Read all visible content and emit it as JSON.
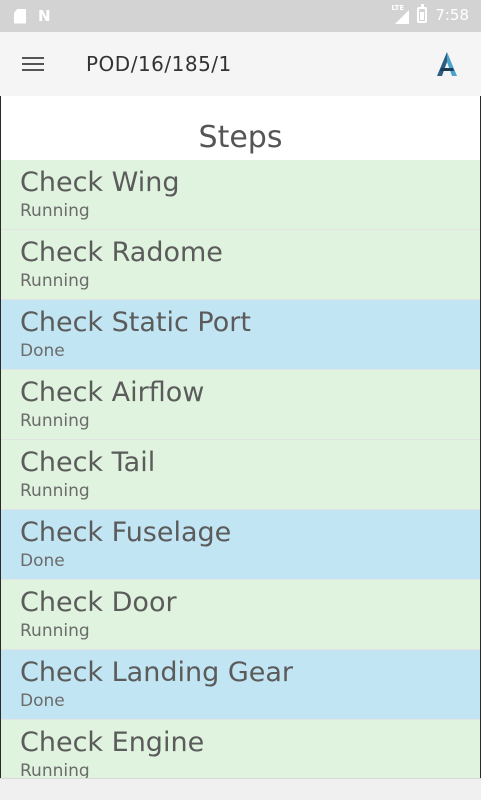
{
  "status_bar": {
    "network_label": "LTE",
    "time": "7:58"
  },
  "app_bar": {
    "title": "POD/16/185/1"
  },
  "page": {
    "heading": "Steps"
  },
  "colors": {
    "running": "#dff3de",
    "done": "#c2e5f3"
  },
  "steps": [
    {
      "name": "Check Wing",
      "status": "Running"
    },
    {
      "name": "Check Radome",
      "status": "Running"
    },
    {
      "name": "Check Static Port",
      "status": "Done"
    },
    {
      "name": "Check Airflow",
      "status": "Running"
    },
    {
      "name": "Check Tail",
      "status": "Running"
    },
    {
      "name": "Check Fuselage",
      "status": "Done"
    },
    {
      "name": "Check Door",
      "status": "Running"
    },
    {
      "name": "Check Landing Gear",
      "status": "Done"
    },
    {
      "name": "Check Engine",
      "status": "Running"
    }
  ]
}
